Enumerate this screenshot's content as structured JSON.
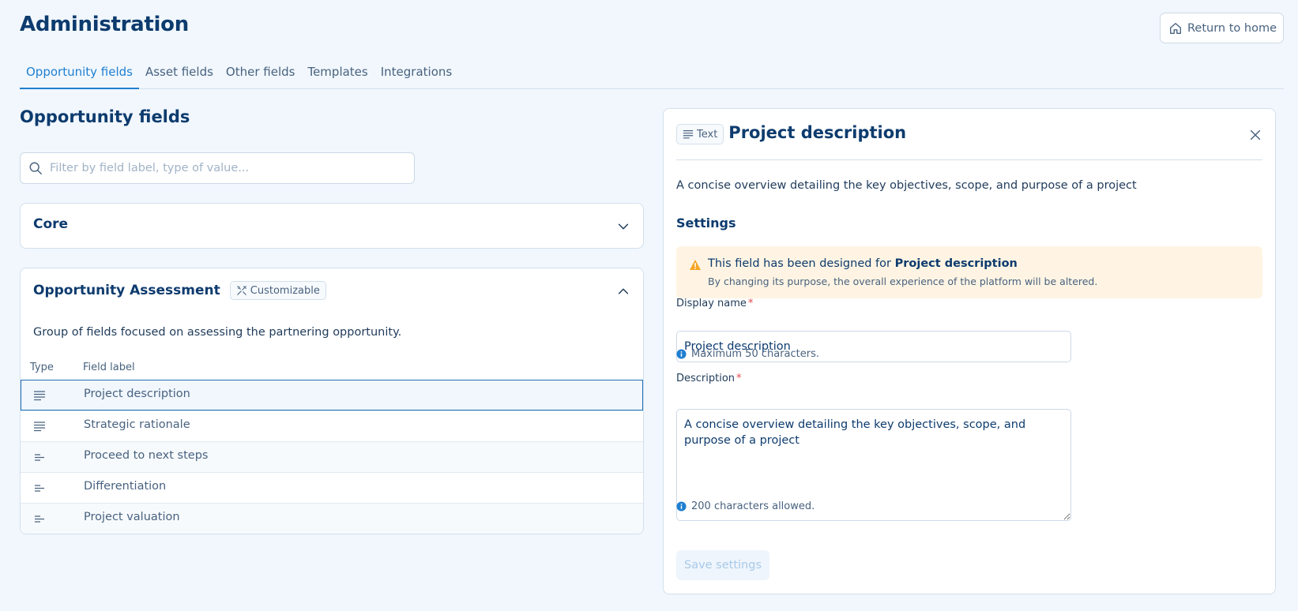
{
  "header": {
    "title": "Administration",
    "return_label": "Return to home"
  },
  "tabs": [
    {
      "label": "Opportunity fields",
      "active": true
    },
    {
      "label": "Asset fields"
    },
    {
      "label": "Other fields"
    },
    {
      "label": "Templates"
    },
    {
      "label": "Integrations"
    }
  ],
  "list": {
    "title": "Opportunity fields",
    "search_placeholder": "Filter by field label, type of value...",
    "core_group": {
      "title": "Core"
    },
    "assessment_group": {
      "title": "Opportunity Assessment",
      "badge": "Customizable",
      "description": "Group of fields focused on assessing the partnering opportunity.",
      "col_type": "Type",
      "col_label": "Field label",
      "rows": [
        {
          "label": "Project description",
          "icon": "long-text-icon",
          "selected": true
        },
        {
          "label": "Strategic rationale",
          "icon": "long-text-icon"
        },
        {
          "label": "Proceed to next steps",
          "icon": "short-text-icon"
        },
        {
          "label": "Differentiation",
          "icon": "short-text-icon"
        },
        {
          "label": "Project valuation",
          "icon": "short-text-icon"
        }
      ]
    }
  },
  "detail": {
    "type_badge": "Text",
    "title": "Project description",
    "description": "A concise overview detailing the key objectives, scope, and purpose of a project",
    "settings_title": "Settings",
    "alert": {
      "prefix": "This field has been designed for ",
      "purpose": "Project description",
      "note": "By changing its purpose, the overall experience of the platform will be altered."
    },
    "display_name": {
      "label": "Display name",
      "value": "Project description",
      "hint": "Maximum 50 characters."
    },
    "description_field": {
      "label": "Description",
      "value": "A concise overview detailing the key objectives, scope, and purpose of a project",
      "hint": "200 characters allowed."
    },
    "save_label": "Save settings"
  },
  "colors": {
    "brand": "#0d3b6e",
    "accent": "#1f7fd1",
    "warning_bg": "#fff4e3",
    "warning_icon": "#f5a524",
    "required": "#e5484d"
  }
}
